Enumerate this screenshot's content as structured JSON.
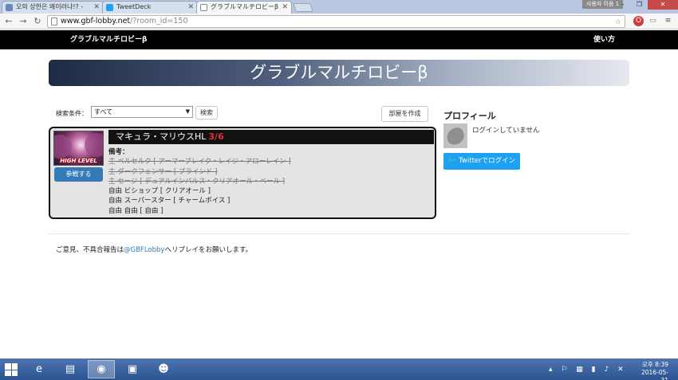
{
  "browser": {
    "tabs": [
      {
        "label": "오의 상한은 왜이러냐!? -",
        "icon": "site-icon"
      },
      {
        "label": "TweetDeck",
        "icon": "twitter-icon"
      },
      {
        "label": "グラブルマルチロビーβ",
        "icon": "page-icon"
      }
    ],
    "user_badge": "사용자 이음 1",
    "url_host": "www.gbf-lobby.net",
    "url_path": "/?room_id=150"
  },
  "site": {
    "brand": "グラブルマルチロビーβ",
    "howto": "使い方",
    "banner_title": "グラブルマルチロビーβ"
  },
  "search": {
    "label": "検索条件：",
    "selected": "すべて",
    "search_button": "検索",
    "create_room_button": "部屋を作成"
  },
  "room": {
    "boss_name": "マキュラ・マリウスHL",
    "count": "3/6",
    "badge": "HIGH LEVEL",
    "join_button": "参戦する",
    "notes_label": "備考：",
    "notes": [
      {
        "text": "主 ベルセルク [ アーマーブレイク・レイジ・アローレイン ]",
        "struck": true
      },
      {
        "text": "主 ダークフェンサー [ ブラインド ]",
        "struck": true
      },
      {
        "text": "主 セージ [ デュアルインパルス・クリアオール・ベール ]",
        "struck": true
      },
      {
        "text": "自由 ビショップ [ クリアオール ]",
        "struck": false
      },
      {
        "text": "自由 スーパースター [ チャームボイス ]",
        "struck": false
      },
      {
        "text": "自由 自由 [ 自由 ]",
        "struck": false
      }
    ]
  },
  "profile": {
    "title": "プロフィール",
    "status": "ログインしていません",
    "twitter_login": "Twitterでログイン"
  },
  "footer": {
    "prefix": "ご意見、不具合報告は",
    "handle": "@GBFLobby",
    "suffix": "へリプレイをお願いします。"
  },
  "taskbar": {
    "clock_time": "오후 8:39",
    "clock_date": "2016-05-31"
  },
  "colors": {
    "accent": "#337ab7",
    "twitter": "#1da1f2",
    "count": "#e53030"
  }
}
